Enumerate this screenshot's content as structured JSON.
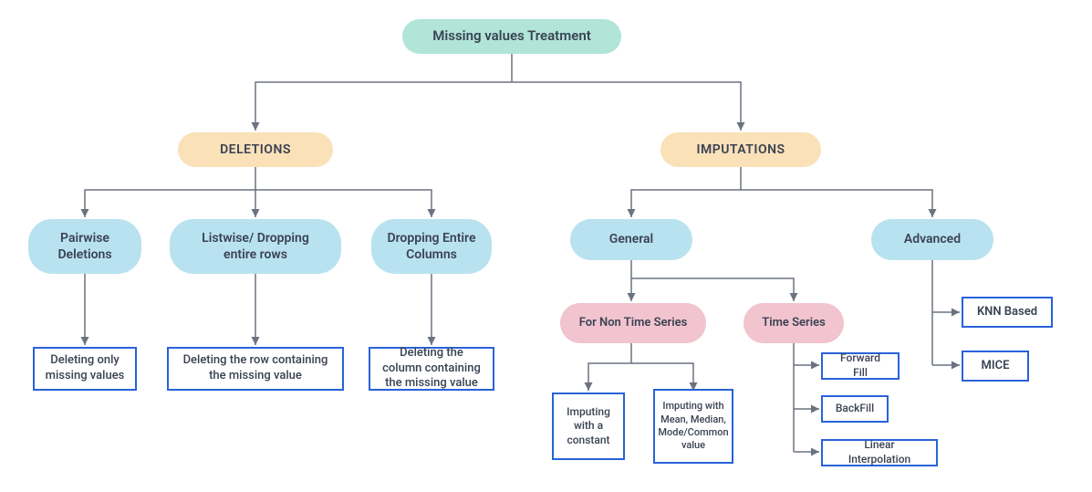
{
  "root": "Missing values Treatment",
  "level1": {
    "deletions": "DELETIONS",
    "imputations": "IMPUTATIONS"
  },
  "deletions": {
    "pair": "Pairwise Deletions",
    "list": "Listwise/ Dropping entire rows",
    "drop": "Dropping Entire Columns",
    "pair_desc": "Deleting only missing values",
    "list_desc": "Deleting the row containing the missing value",
    "drop_desc": "Deleting the column containing the missing value"
  },
  "imputations": {
    "general": "General",
    "advanced": "Advanced",
    "nonts": "For Non Time Series",
    "ts": "Time Series",
    "const": "Imputing with a constant",
    "mmm": "Imputing with Mean, Median, Mode/Common value",
    "ff": "Forward Fill",
    "bf": "BackFill",
    "li": "Linear Interpolation",
    "knn": "KNN Based",
    "mice": "MICE"
  }
}
